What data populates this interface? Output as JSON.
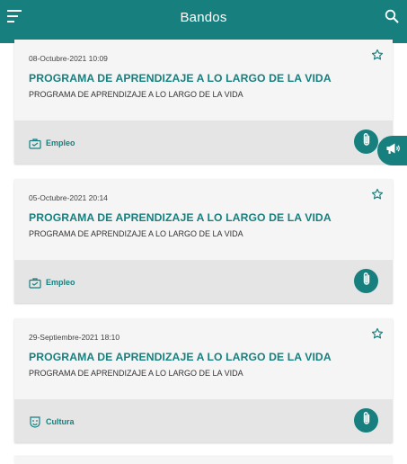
{
  "appbar": {
    "title": "Bandos",
    "menu_icon": "menu-icon",
    "search_icon": "search-icon"
  },
  "theme": {
    "accent": "#17807f",
    "card_bg": "#f5f5f5",
    "footer_bg": "#e5e5e5"
  },
  "cards": [
    {
      "date": "08-Octubre-2021 10:09",
      "title": "PROGRAMA DE APRENDIZAJE A LO LARGO DE LA VIDA",
      "summary": "PROGRAMA DE APRENDIZAJE A LO LARGO DE LA VIDA",
      "category": "Empleo",
      "category_icon": "briefcase-icon",
      "favorite": false
    },
    {
      "date": "05-Octubre-2021 20:14",
      "title": "PROGRAMA DE APRENDIZAJE A LO LARGO DE LA VIDA",
      "summary": "PROGRAMA DE APRENDIZAJE A LO LARGO DE LA VIDA",
      "category": "Empleo",
      "category_icon": "briefcase-icon",
      "favorite": false
    },
    {
      "date": "29-Septiembre-2021 18:10",
      "title": "PROGRAMA DE APRENDIZAJE A LO LARGO DE LA VIDA",
      "summary": "PROGRAMA DE APRENDIZAJE A LO LARGO DE LA VIDA",
      "category": "Cultura",
      "category_icon": "culture-icon",
      "favorite": false
    }
  ],
  "fab_icon": "megaphone-icon"
}
